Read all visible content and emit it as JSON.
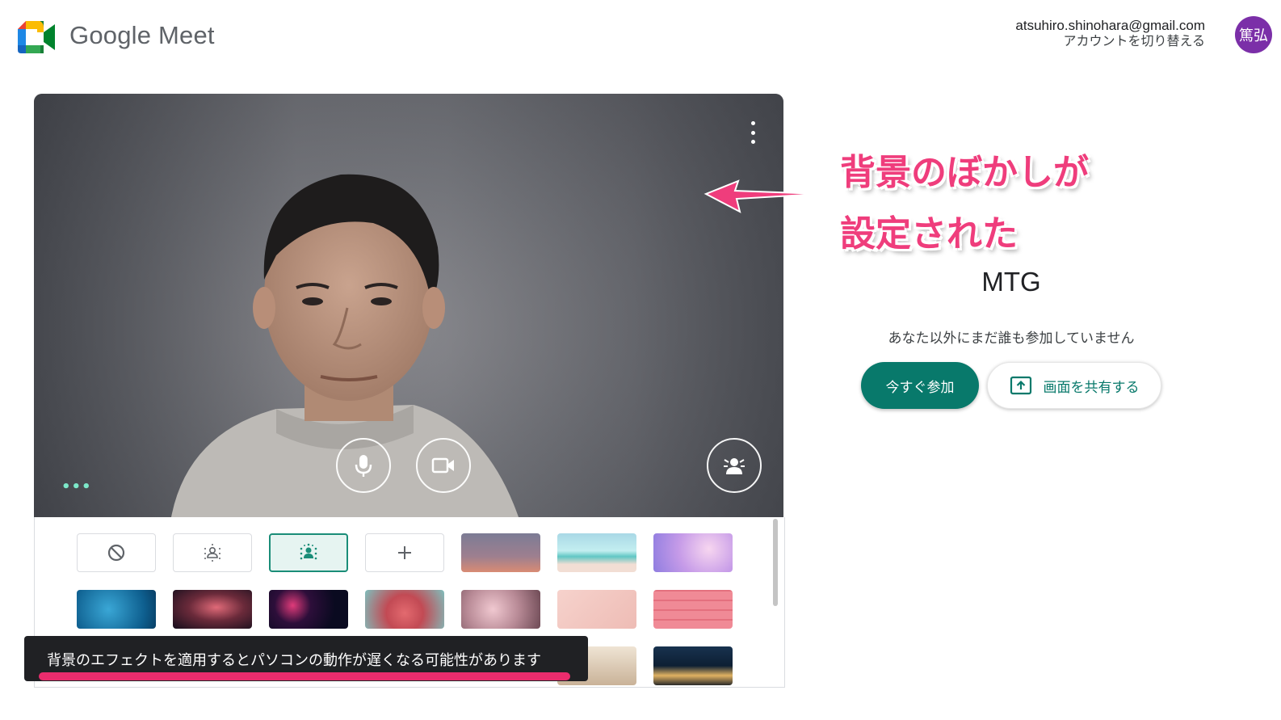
{
  "app": {
    "title": "Google Meet"
  },
  "account": {
    "email": "atsuhiro.shinohara@gmail.com",
    "switch_label": "アカウントを切り替える",
    "avatar_text": "篤弘",
    "avatar_color": "#7b2fa8"
  },
  "preview": {
    "more_options_icon": "more-vert-icon",
    "ellipsis_text": "•••"
  },
  "controls": {
    "mic_icon": "microphone-icon",
    "camera_icon": "camera-icon",
    "effects_icon": "background-effects-icon"
  },
  "backgrounds": {
    "options": [
      "no-effect",
      "slight-blur",
      "blur",
      "upload-background"
    ],
    "selected": "blur",
    "image_count_visible": 16
  },
  "toast": {
    "message": "背景のエフェクトを適用するとパソコンの動作が遅くなる可能性があります"
  },
  "annotation": {
    "line1": "背景のぼかしが",
    "line2": "設定された",
    "color": "#ef3d7c"
  },
  "meeting": {
    "title": "MTG",
    "status": "あなた以外にまだ誰も参加していません",
    "join_label": "今すぐ参加",
    "share_label": "画面を共有する"
  },
  "colors": {
    "accent": "#08796b",
    "highlight": "#ea2c6d"
  }
}
